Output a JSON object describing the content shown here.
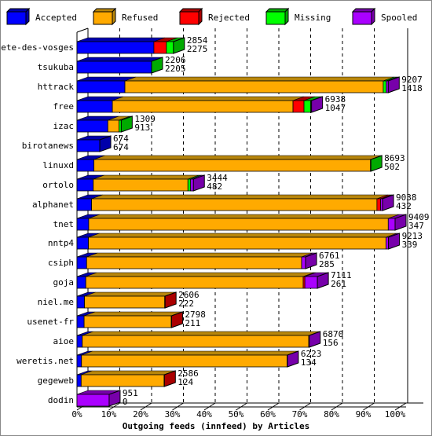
{
  "chart_data": {
    "type": "bar",
    "orientation": "horizontal",
    "stacked": true,
    "title": "Outgoing feeds (innfeed) by Articles",
    "xlabel": "",
    "ylabel": "",
    "xlim": [
      0,
      100
    ],
    "x_unit": "%",
    "x_ticks": [
      "0%",
      "10%",
      "20%",
      "30%",
      "40%",
      "50%",
      "60%",
      "70%",
      "80%",
      "90%",
      "100%"
    ],
    "grid": true,
    "legend_position": "top",
    "series": [
      {
        "name": "Accepted",
        "color": "#0000ff",
        "dark": "#0000aa"
      },
      {
        "name": "Refused",
        "color": "#ffaa00",
        "dark": "#b8860b"
      },
      {
        "name": "Rejected",
        "color": "#ff0000",
        "dark": "#aa0000"
      },
      {
        "name": "Missing",
        "color": "#00ff00",
        "dark": "#00aa00"
      },
      {
        "name": "Spooled",
        "color": "#aa00ff",
        "dark": "#7700aa"
      }
    ],
    "categories": [
      "bete-des-vosges",
      "tsukuba",
      "httrack",
      "free",
      "izac",
      "birotanews",
      "linuxd",
      "ortolo",
      "alphanet",
      "tnet",
      "nntp4",
      "csiph",
      "goja",
      "niel.me",
      "usenet-fr",
      "aioe",
      "weretis.net",
      "gegeweb",
      "dodin"
    ],
    "totals": [
      2854,
      2206,
      9207,
      6938,
      1309,
      674,
      8693,
      3444,
      9038,
      9409,
      9213,
      6761,
      7111,
      2606,
      2798,
      6870,
      6223,
      2586,
      951
    ],
    "accepted": [
      2275,
      2205,
      1418,
      1047,
      913,
      674,
      502,
      482,
      432,
      347,
      339,
      285,
      261,
      222,
      211,
      156,
      134,
      124,
      0
    ],
    "values": [
      [
        2275,
        0,
        370,
        209,
        0
      ],
      [
        2205,
        0,
        0,
        1,
        0
      ],
      [
        1418,
        7640,
        0,
        90,
        59
      ],
      [
        1047,
        5343,
        325,
        200,
        23
      ],
      [
        913,
        330,
        0,
        66,
        0
      ],
      [
        674,
        0,
        0,
        0,
        0
      ],
      [
        502,
        8180,
        0,
        11,
        0
      ],
      [
        482,
        2800,
        0,
        80,
        82
      ],
      [
        432,
        8440,
        110,
        0,
        56
      ],
      [
        347,
        8860,
        0,
        0,
        202
      ],
      [
        339,
        8800,
        0,
        0,
        74
      ],
      [
        285,
        6360,
        0,
        0,
        116
      ],
      [
        261,
        6430,
        50,
        0,
        370
      ],
      [
        222,
        2374,
        10,
        0,
        0
      ],
      [
        211,
        2577,
        10,
        0,
        0
      ],
      [
        156,
        6700,
        0,
        0,
        14
      ],
      [
        134,
        6080,
        0,
        0,
        9
      ],
      [
        124,
        2452,
        10,
        0,
        0
      ],
      [
        0,
        0,
        0,
        0,
        951
      ]
    ]
  }
}
